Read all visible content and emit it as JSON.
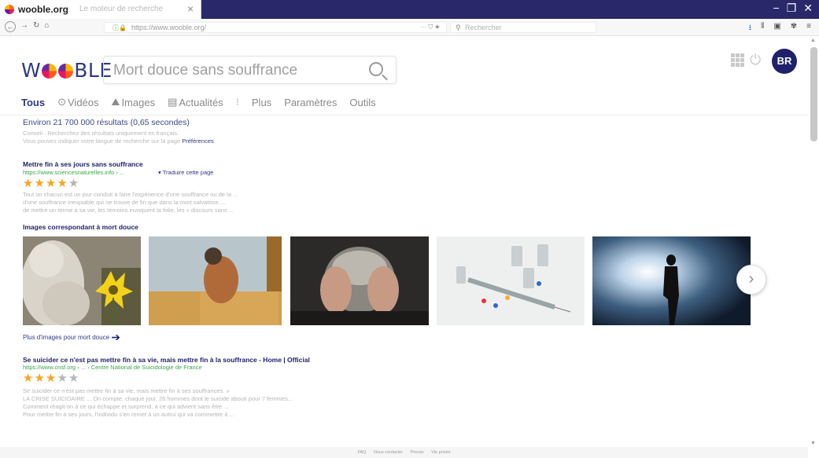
{
  "browser": {
    "tab_title": "wooble.org",
    "tab_subtitle": "Le moteur de recherche",
    "tab_close": "×",
    "url": "https://www.wooble.org/",
    "search_placeholder": "Rechercher",
    "window_controls": [
      "−",
      "❐",
      "✕"
    ]
  },
  "brand": {
    "logo_left": "W",
    "logo_right": "BLE"
  },
  "search": {
    "query": "Mort douce sans souffrance"
  },
  "user": {
    "initials": "BR"
  },
  "tabs": [
    {
      "label": "Tous"
    },
    {
      "label": "Vidéos",
      "icon": "⊙"
    },
    {
      "label": "Images",
      "icon": "⛰"
    },
    {
      "label": "Actualités",
      "icon": "▤"
    },
    {
      "label": "Plus"
    },
    {
      "label": "Paramètres"
    },
    {
      "label": "Outils"
    }
  ],
  "tabs_separator": "⁝",
  "results_info": {
    "count": "Environ 21 700 000 résultats (0,65 secondes)",
    "hint_line1": "Conseil : Recherchez des résultats uniquement en français.",
    "hint_line2": "Vous pouvez indiquer votre langue de recherche sur la page",
    "hint_link": "Préférences"
  },
  "result1": {
    "title": "Mettre fin à ses jours sans souffrance",
    "url": "https://www.sciencesnaturelles.info › ...",
    "translate": "Traduire cette page",
    "rating": 4,
    "snippet": [
      "Tout un chacun est un jour conduit à faire l'expérience d'une souffrance ou de la ...",
      "d'une souffrance inexpiable qui ne trouve de fin que dans la mort salvatrice. ...",
      "de mettre un terme à sa vie, les témoins invoquent la folie, les « discours sans ..."
    ]
  },
  "images_section": {
    "heading": "Images correspondant à mort douce",
    "more_link": "Plus d'images pour mort douce",
    "tiles": [
      "statue-with-flower",
      "woman-by-window",
      "man-head-in-hands",
      "syringe-and-pills",
      "silhouette-in-light"
    ]
  },
  "result2": {
    "title": "Se suicider ce n'est pas mettre fin à sa vie, mais mettre fin à la souffrance - Home | Official",
    "url": "https://www.cnsf.org › ... › Centre National de Suicidologie de France",
    "rating": 3,
    "snippet": [
      "Se suicider ce n'est pas mettre fin à sa vie, mais mettre fin à ses souffrances. »",
      "LA CRISE SUICIDAIRE ... On compte, chaque jour, 26 hommes dont le suicide abouti pour 7 femmes...",
      "Comment réagit-on à ce qui échappe et surprend, à ce qui advient sans être ...",
      "Pour mettre fin à ses jours, l'individu s'en remet à un autrui qui va commettre à ..."
    ]
  },
  "footer": [
    "FAQ",
    "Nous contacter",
    "Presse",
    "Vie privée"
  ],
  "colors": {
    "brand_navy": "#20216b",
    "link_green": "#3aa64b",
    "star": "#f5a623"
  }
}
